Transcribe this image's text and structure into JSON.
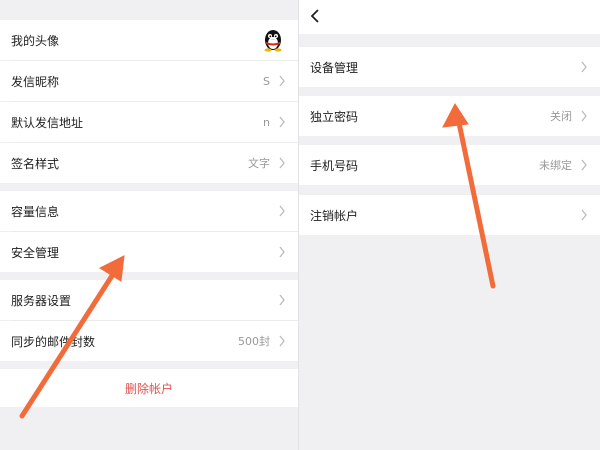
{
  "left": {
    "rows": [
      {
        "label": "我的头像",
        "value": ""
      },
      {
        "label": "发信昵称",
        "value": "S"
      },
      {
        "label": "默认发信地址",
        "value": "n"
      },
      {
        "label": "签名样式",
        "value": "文字"
      },
      {
        "label": "容量信息",
        "value": ""
      },
      {
        "label": "安全管理",
        "value": ""
      },
      {
        "label": "服务器设置",
        "value": ""
      },
      {
        "label": "同步的邮件封数",
        "value": "500封"
      }
    ],
    "delete_label": "删除帐户"
  },
  "right": {
    "rows": [
      {
        "label": "设备管理",
        "value": ""
      },
      {
        "label": "独立密码",
        "value": "关闭"
      },
      {
        "label": "手机号码",
        "value": "未绑定"
      },
      {
        "label": "注销帐户",
        "value": ""
      }
    ]
  },
  "icons": {
    "avatar": "qq-penguin-icon",
    "back": "back-arrow-icon",
    "chevron": "chevron-right-icon"
  },
  "colors": {
    "annotation_arrow": "#f26b3a",
    "delete_text": "#e0524f",
    "background": "#f0f0f2"
  }
}
